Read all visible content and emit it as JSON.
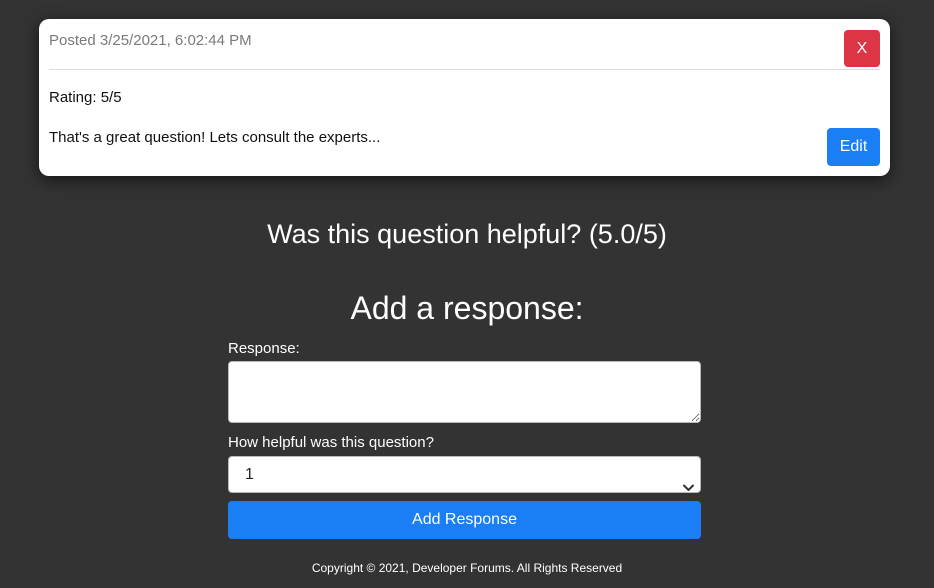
{
  "card": {
    "posted": "Posted 3/25/2021, 6:02:44 PM",
    "close_label": "X",
    "rating": "Rating: 5/5",
    "body": "That's a great question! Lets consult the experts...",
    "edit_label": "Edit"
  },
  "helpful_heading": "Was this question helpful? (5.0/5)",
  "form": {
    "heading": "Add a response:",
    "response_label": "Response:",
    "response_value": "",
    "helpful_label": "How helpful was this question?",
    "helpful_selected": "1",
    "submit_label": "Add Response"
  },
  "footer": "Copyright © 2021, Developer Forums. All Rights Reserved",
  "colors": {
    "background": "#333333",
    "primary": "#1a7ef5",
    "danger": "#dc3545"
  },
  "icons": {
    "select_arrow": "chevron-down-icon"
  }
}
